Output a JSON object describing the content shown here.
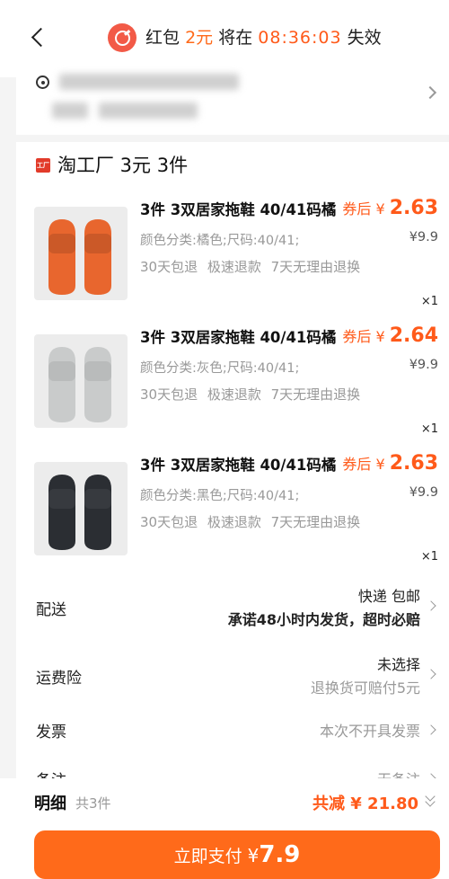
{
  "header": {
    "prefix": "红包",
    "amount": "2元",
    "mid": "将在",
    "time": "08:36:03",
    "suffix": "失效"
  },
  "shop": {
    "badge": "工厂",
    "name": "淘工厂 3元 3件"
  },
  "items": [
    {
      "title": "3件 3双居家拖鞋 40/41码橘",
      "price_label": "券后",
      "price_yen": "¥",
      "price": "2.63",
      "spec": "颜色分类:橘色;尺码:40/41;",
      "original": "¥9.9",
      "tags": "30天包退 极速退款 7天无理由退换",
      "qty": "×1",
      "color": "#e8662e"
    },
    {
      "title": "3件 3双居家拖鞋 40/41码橘",
      "price_label": "券后",
      "price_yen": "¥",
      "price": "2.64",
      "spec": "颜色分类:灰色;尺码:40/41;",
      "original": "¥9.9",
      "tags": "30天包退 极速退款 7天无理由退换",
      "qty": "×1",
      "color": "#c9cbcb"
    },
    {
      "title": "3件 3双居家拖鞋 40/41码橘",
      "price_label": "券后",
      "price_yen": "¥",
      "price": "2.63",
      "spec": "颜色分类:黑色;尺码:40/41;",
      "original": "¥9.9",
      "tags": "30天包退 极速退款 7天无理由退换",
      "qty": "×1",
      "color": "#2b2e33"
    }
  ],
  "delivery": {
    "label": "配送",
    "line1": "快递 包邮",
    "line2": "承诺48小时内发货，超时必赔"
  },
  "insurance": {
    "label": "运费险",
    "line1": "未选择",
    "line2": "退换货可赔付5元"
  },
  "invoice": {
    "label": "发票",
    "value": "本次不开具发票"
  },
  "note": {
    "label": "备注",
    "value": "无备注"
  },
  "summary": {
    "detail_label": "明细",
    "count": "共3件",
    "discount": "共减 ¥ 21.80"
  },
  "pay": {
    "label": "立即支付",
    "yen": "¥",
    "amount": "7.9"
  }
}
